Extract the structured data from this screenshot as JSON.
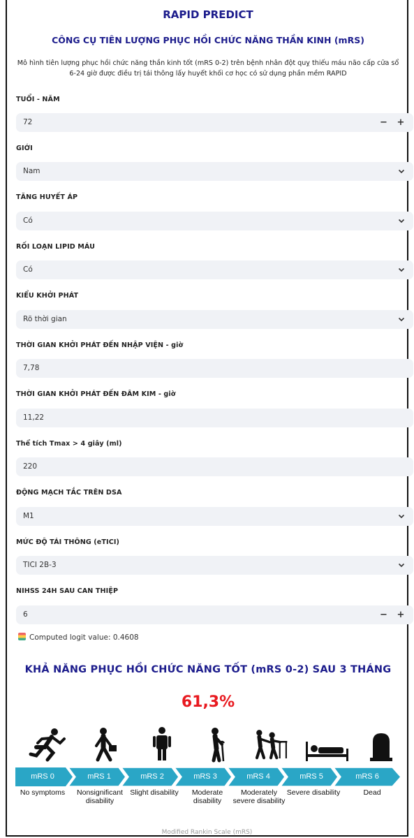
{
  "header": {
    "title": "RAPID PREDICT",
    "subtitle": "CÔNG CỤ TIÊN LƯỢNG PHỤC HỒI CHỨC NĂNG THẦN KINH (mRS)",
    "description": "Mô hình tiên lượng phục hồi chức năng thần kinh tốt (mRS 0-2) trên bệnh nhân đột quỵ thiếu máu não cấp cửa sổ 6-24 giờ được điều trị tái thông lấy huyết khối cơ học có sử dụng phần mềm RAPID"
  },
  "form": {
    "age": {
      "label": "TUỔI - NĂM",
      "value": "72",
      "minus": "−",
      "plus": "+"
    },
    "sex": {
      "label": "GIỚI",
      "value": "Nam"
    },
    "hypertension": {
      "label": "TĂNG HUYẾT ÁP",
      "value": "Có"
    },
    "dyslipidemia": {
      "label": "RỐI LOẠN LIPID MÁU",
      "value": "Có"
    },
    "onset_type": {
      "label": "KIỂU KHỞI PHÁT",
      "value": "Rõ thời gian"
    },
    "onset_to_admission": {
      "label": "THỜI GIAN KHỞI PHÁT ĐẾN NHẬP VIỆN - giờ",
      "value": "7,78"
    },
    "onset_to_puncture": {
      "label": "THỜI GIAN KHỞI PHÁT ĐẾN ĐÂM KIM - giờ",
      "value": "11,22"
    },
    "tmax_volume": {
      "label": "Thể tích Tmax > 4 giây (ml)",
      "value": "220"
    },
    "occluded_artery": {
      "label": "ĐỘNG MẠCH TẮC TRÊN DSA",
      "value": "M1"
    },
    "reperfusion": {
      "label": "MỨC ĐỘ TÁI THÔNG (eTICI)",
      "value": "TICI 2B-3"
    },
    "nihss": {
      "label": "NIHSS 24H SAU CAN THIỆP",
      "value": "6",
      "minus": "−",
      "plus": "+"
    }
  },
  "logit_text": "Computed logit value: 0.4608",
  "result": {
    "title": "KHẢ NĂNG PHỤC HỒI CHỨC NĂNG TỐT (mRS 0-2) SAU 3 THÁNG",
    "probability": "61,3%",
    "probability_color": "#e8191f"
  },
  "mrs_scale": {
    "color": "#2aa6c6",
    "levels": [
      {
        "label": "mRS 0",
        "caption": "No symptoms",
        "icon": "running-person-icon"
      },
      {
        "label": "mRS 1",
        "caption": "Nonsignificant disability",
        "icon": "walking-person-briefcase-icon"
      },
      {
        "label": "mRS 2",
        "caption": "Slight disability",
        "icon": "standing-person-icon"
      },
      {
        "label": "mRS 3",
        "caption": "Moderate disability",
        "icon": "person-with-cane-icon"
      },
      {
        "label": "mRS 4",
        "caption": "Moderately severe disability",
        "icon": "person-with-walker-assisted-icon"
      },
      {
        "label": "mRS 5",
        "caption": "Severe disability",
        "icon": "bedridden-person-icon"
      },
      {
        "label": "mRS 6",
        "caption": "Dead",
        "icon": "tombstone-icon"
      }
    ],
    "caption": "Modified Rankin Scale (mRS)"
  }
}
